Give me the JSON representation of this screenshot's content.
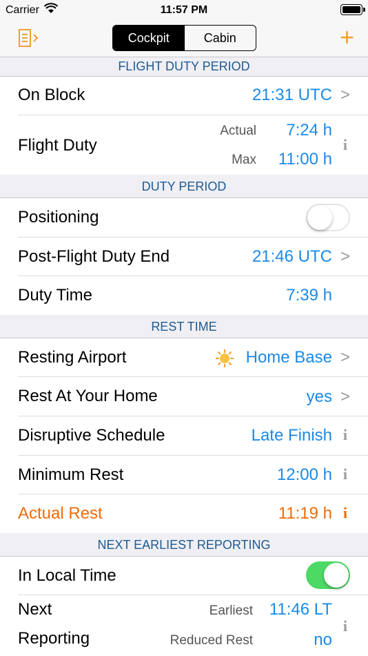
{
  "status_bar": {
    "carrier": "Carrier",
    "time": "11:57 PM"
  },
  "nav": {
    "segments": [
      "Cockpit",
      "Cabin"
    ],
    "active_segment": "Cockpit",
    "accent_color": "#f0a030"
  },
  "sections": {
    "fdp": {
      "header": "FLIGHT DUTY PERIOD",
      "on_block": {
        "label": "On Block",
        "value": "21:31 UTC"
      },
      "flight_duty": {
        "label": "Flight Duty",
        "actual_label": "Actual",
        "actual_value": "7:24 h",
        "max_label": "Max",
        "max_value": "11:00 h"
      }
    },
    "duty": {
      "header": "DUTY PERIOD",
      "positioning": {
        "label": "Positioning",
        "on": false
      },
      "post_flight": {
        "label": "Post-Flight Duty End",
        "value": "21:46 UTC"
      },
      "duty_time": {
        "label": "Duty Time",
        "value": "7:39 h"
      }
    },
    "rest": {
      "header": "REST TIME",
      "resting_airport": {
        "label": "Resting Airport",
        "value": "Home Base",
        "icon": "sun-icon"
      },
      "rest_home": {
        "label": "Rest At Your Home",
        "value": "yes"
      },
      "disruptive": {
        "label": "Disruptive Schedule",
        "value": "Late Finish"
      },
      "min_rest": {
        "label": "Minimum Rest",
        "value": "12:00 h"
      },
      "actual_rest": {
        "label": "Actual Rest",
        "value": "11:19 h",
        "color": "#ee6b0b"
      }
    },
    "next": {
      "header": "NEXT EARLIEST REPORTING",
      "local_time": {
        "label": "In Local Time",
        "on": true
      },
      "next_reporting": {
        "label_line1": "Next",
        "label_line2": "Reporting",
        "earliest_label": "Earliest",
        "earliest_value": "11:46 LT",
        "reduced_label": "Reduced Rest",
        "reduced_value": "no"
      }
    }
  }
}
